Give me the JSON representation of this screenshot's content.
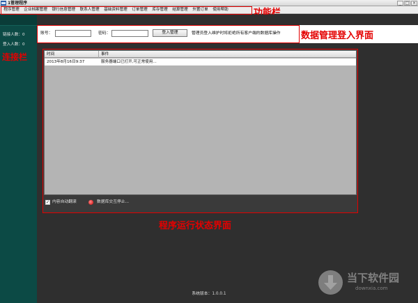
{
  "window": {
    "title": "1管理程序",
    "min_label": "_",
    "max_label": "□",
    "close_label": "×"
  },
  "menu": {
    "items": [
      "程序管理",
      "企业档案管理",
      "银行信息管理",
      "联系人管理",
      "基础资料管理",
      "订单管理",
      "库存管理",
      "结算管理",
      "外置订单",
      "使用帮助"
    ]
  },
  "annotations": {
    "menu_bar": "功能栏",
    "login_bar": "数据管理登入界面",
    "sidebar": "连接栏",
    "log_panel": "程序运行状态界面"
  },
  "sidebar": {
    "stats": [
      {
        "label": "链接人数：",
        "value": "0"
      },
      {
        "label": "登入人数：",
        "value": "0"
      }
    ]
  },
  "login": {
    "account_label": "账号：",
    "account_value": "",
    "password_label": "密码：",
    "password_value": "",
    "login_button": "登入管理",
    "notice": "管理员登入维护时将拒绝所有客户端的数据库操作"
  },
  "log": {
    "columns": [
      "时间",
      "事件"
    ],
    "rows": [
      {
        "time": "2013年8月16日9:37",
        "event": "服务器端口已打开,可正常使用..."
      }
    ]
  },
  "footer": {
    "auto_scroll_label": "内容自动翻滚",
    "auto_scroll_checked": true,
    "check_mark": "✓",
    "db_status": "数据库交互停止..."
  },
  "version": "系统版本：1.0.0.1",
  "watermark": {
    "title": "当下软件园",
    "url": "downxia.com"
  }
}
